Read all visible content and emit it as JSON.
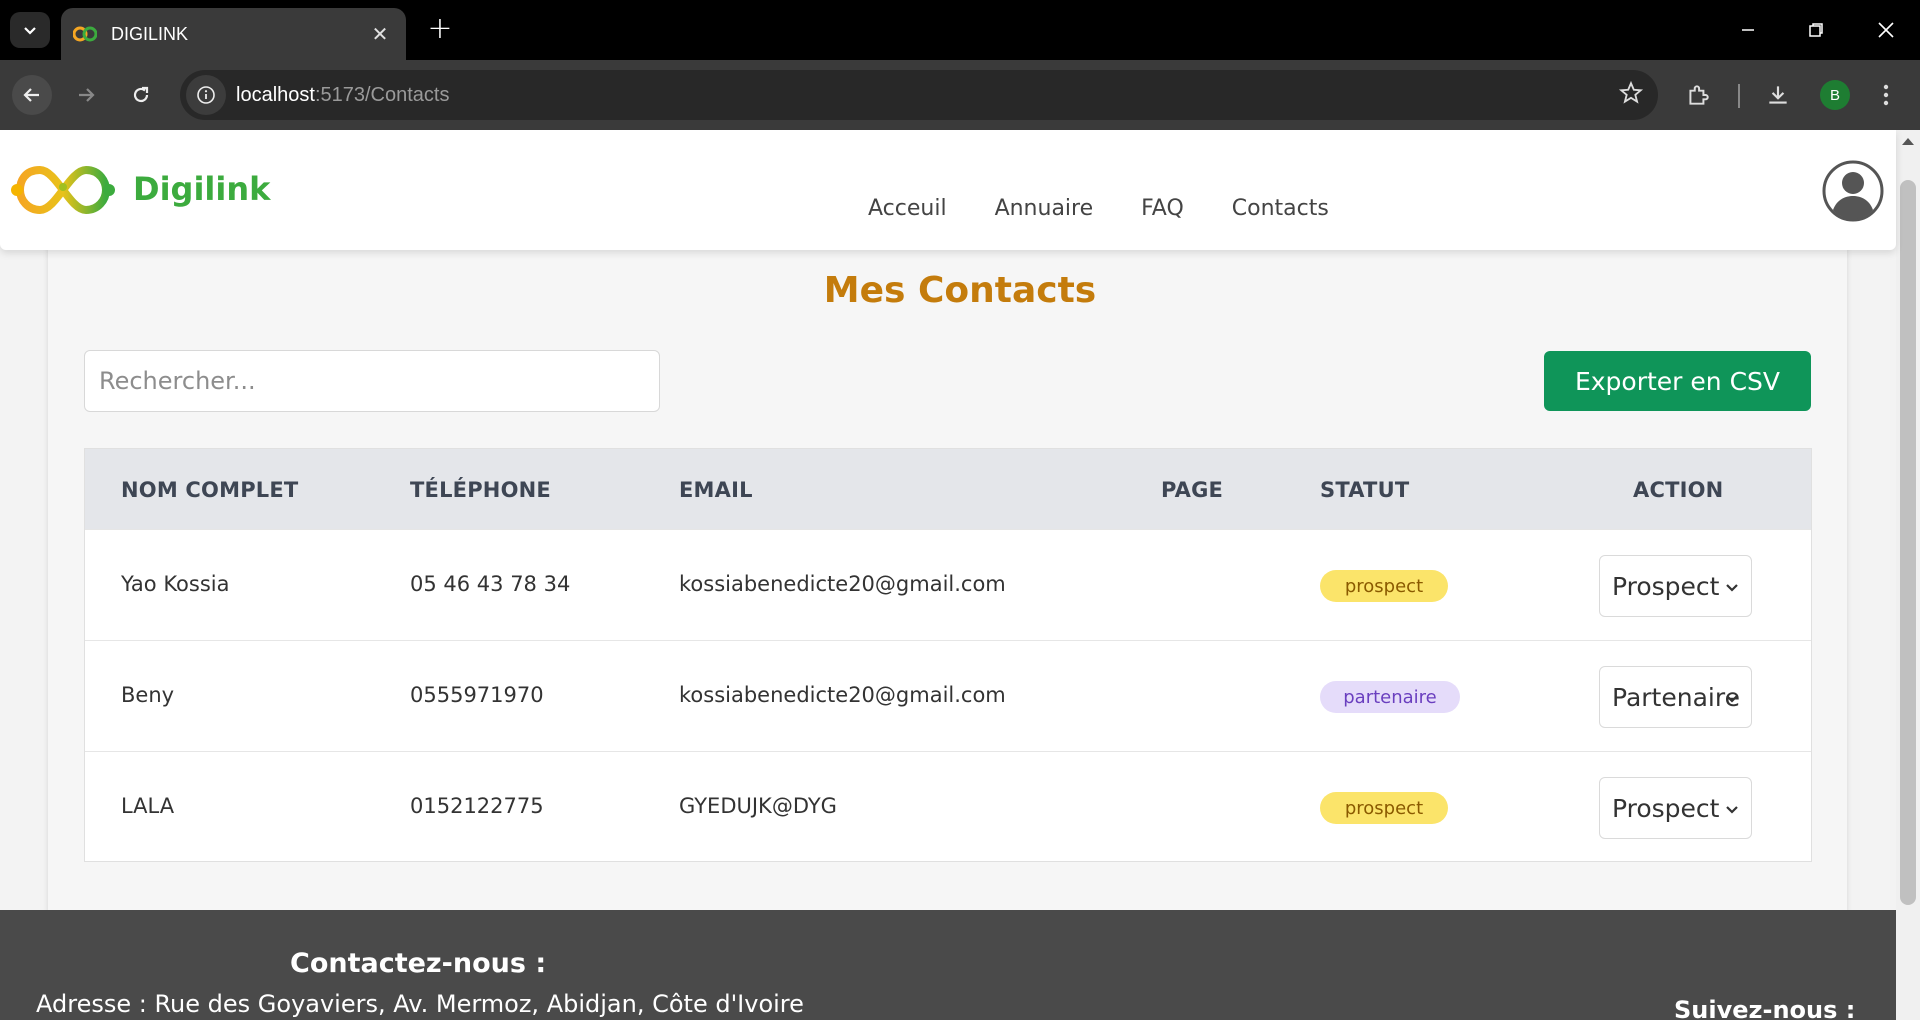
{
  "browser": {
    "tab_title": "DIGILINK",
    "url_host": "localhost",
    "url_path": ":5173/Contacts",
    "profile_initial": "B"
  },
  "site": {
    "brand": "Digilink",
    "nav": [
      "Acceuil",
      "Annuaire",
      "FAQ",
      "Contacts"
    ],
    "brand_color": "#3cab3e"
  },
  "main": {
    "title": "Mes Contacts",
    "search_placeholder": "Rechercher...",
    "export_label": "Exporter en CSV",
    "title_color": "#c47c0c",
    "export_color": "#0f9559"
  },
  "table": {
    "headers": {
      "name": "NOM COMPLET",
      "phone": "TÉLÉPHONE",
      "email": "EMAIL",
      "page": "PAGE",
      "status": "STATUT",
      "action": "ACTION"
    },
    "rows": [
      {
        "name": "Yao Kossia",
        "phone": "05 46 43 78 34",
        "email": "kossiabenedicte20@gmail.com",
        "page": "",
        "status": "prospect",
        "action": "Prospect"
      },
      {
        "name": "Beny",
        "phone": "0555971970",
        "email": "kossiabenedicte20@gmail.com",
        "page": "",
        "status": "partenaire",
        "action": "Partenaire"
      },
      {
        "name": "LALA",
        "phone": "0152122775",
        "email": "GYEDUJK@DYG",
        "page": "",
        "status": "prospect",
        "action": "Prospect"
      }
    ]
  },
  "footer": {
    "contact_title": "Contactez-nous :",
    "address": "Adresse : Rue des Goyaviers, Av. Mermoz, Abidjan, Côte d'Ivoire",
    "follow_title": "Suivez-nous :"
  }
}
